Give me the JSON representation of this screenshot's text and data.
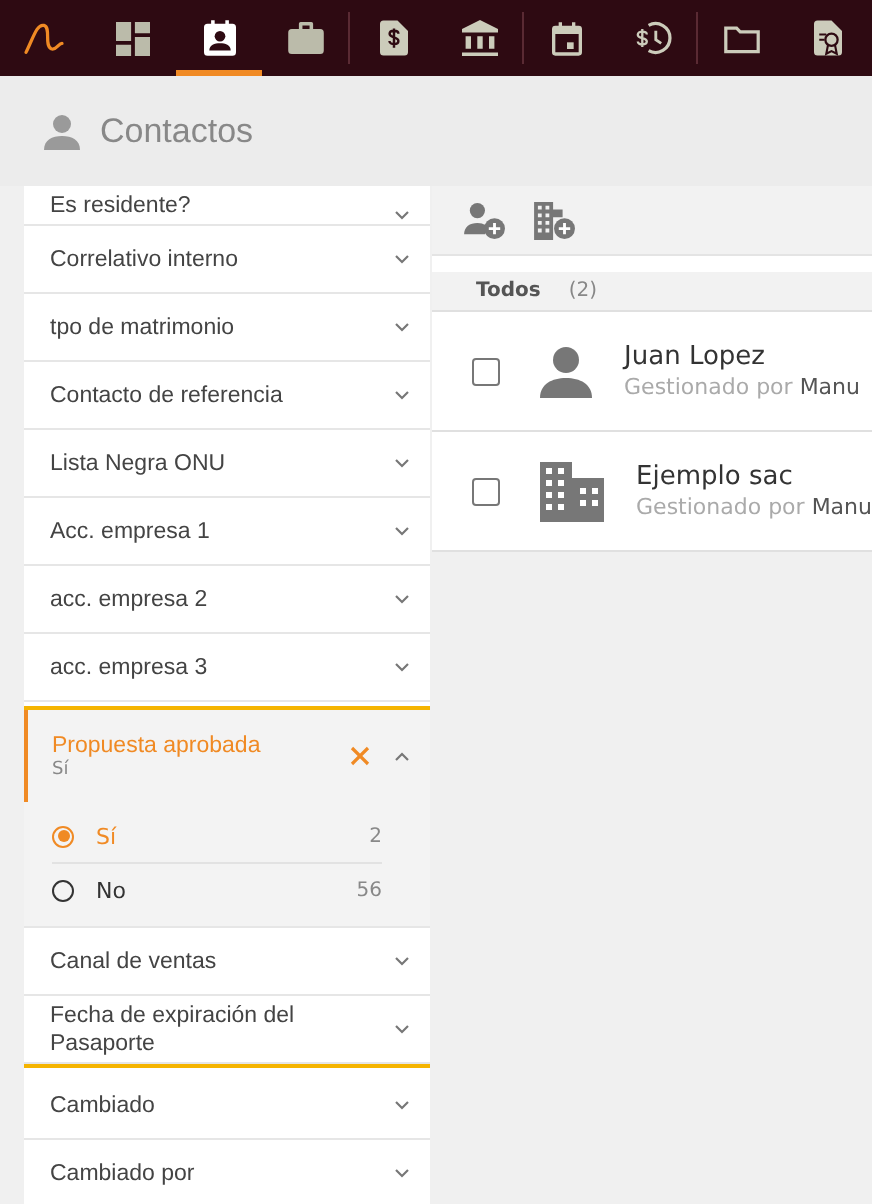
{
  "nav": {
    "items": [
      {
        "selected": false
      },
      {
        "selected": true
      },
      {
        "selected": false
      },
      {
        "selected": false
      },
      {
        "selected": false
      },
      {
        "selected": false
      },
      {
        "selected": false
      },
      {
        "selected": false
      },
      {
        "selected": false
      }
    ]
  },
  "header": {
    "title": "Contactos"
  },
  "filter_groups": [
    {
      "highlighted": false,
      "filters": [
        {
          "label": "Es residente?",
          "expanded": false
        },
        {
          "label": "Correlativo interno",
          "expanded": false
        },
        {
          "label": "tpo de matrimonio",
          "expanded": false
        },
        {
          "label": "Contacto de referencia",
          "expanded": false
        },
        {
          "label": "Lista Negra ONU",
          "expanded": false
        },
        {
          "label": "Acc. empresa 1",
          "expanded": false
        },
        {
          "label": "acc. empresa 2",
          "expanded": false
        },
        {
          "label": "acc. empresa 3",
          "expanded": false
        }
      ]
    },
    {
      "highlighted": true,
      "filters": [
        {
          "label": "Propuesta aprobada",
          "expanded": true,
          "value": "Sí",
          "options": [
            {
              "label": "Sí",
              "count": "2",
              "selected": true
            },
            {
              "label": "No",
              "count": "56",
              "selected": false
            }
          ]
        },
        {
          "label": "Canal de ventas",
          "expanded": false
        },
        {
          "label": "Fecha de expiración del Pasaporte",
          "expanded": false
        }
      ]
    },
    {
      "highlighted": false,
      "filters": [
        {
          "label": "Cambiado",
          "expanded": false
        },
        {
          "label": "Cambiado por",
          "expanded": false
        }
      ]
    }
  ],
  "list": {
    "group_label": "Todos",
    "count": "(2)",
    "rows": [
      {
        "kind": "person",
        "name": "Juan Lopez",
        "managed_prefix": "Gestionado por",
        "managed_by": "Manu",
        "checked": false
      },
      {
        "kind": "company",
        "name": "Ejemplo sac",
        "managed_prefix": "Gestionado por",
        "managed_by": "Manu",
        "checked": false
      }
    ]
  }
}
